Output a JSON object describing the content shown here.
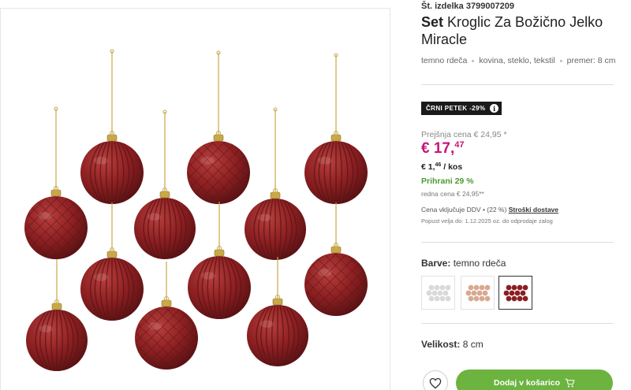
{
  "product": {
    "sku": "Št. izdelka 3799007209",
    "title_bold": "Set",
    "title_rest": "Kroglic Za Božično Jelko Miracle",
    "attributes": [
      "temno rdeča",
      "kovina, steklo, tekstil",
      "premer: 8 cm"
    ]
  },
  "promo": {
    "badge": "ČRNI PETEK -29%",
    "badge_info_icon": "info-icon"
  },
  "pricing": {
    "previous": "Prejšnja cena € 24,95 *",
    "price_main": "€ 17,",
    "price_cents": "47",
    "unit_main": "€ 1,",
    "unit_cents": "46",
    "unit_suffix": " / kos",
    "saved": "Prihrani 29 %",
    "regular": "redna cena € 24,95**",
    "vat": "Cena vključuje DDV • (22 %)",
    "shipping_link": "Stroški dostave",
    "validity": "Popust velja do: 1.12.2025 oz. do odprodaje zalog"
  },
  "colors": {
    "label": "Barve:",
    "selected": "temno rdeča",
    "options": [
      {
        "color": "#d9d9d9",
        "selected": false
      },
      {
        "color": "#d9a98f",
        "selected": false
      },
      {
        "color": "#8a1f22",
        "selected": true
      }
    ]
  },
  "size": {
    "label": "Velikost:",
    "value": "8 cm"
  },
  "actions": {
    "wishlist_icon": "heart-icon",
    "cart_label": "Dodaj v košarico",
    "cart_icon": "cart-icon"
  },
  "theme": {
    "accent_price": "#c8157a",
    "accent_green": "#6cb33f",
    "ornament": "#8a1f22"
  }
}
